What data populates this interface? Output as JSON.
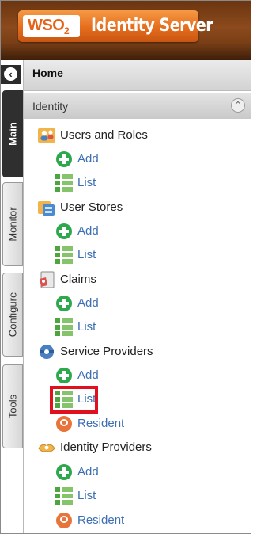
{
  "app": {
    "logo_brand": "WSO",
    "logo_sub": "2",
    "logo_product": "Identity Server"
  },
  "tabs": [
    {
      "label": "Main",
      "active": true
    },
    {
      "label": "Monitor",
      "active": false
    },
    {
      "label": "Configure",
      "active": false
    },
    {
      "label": "Tools",
      "active": false
    }
  ],
  "collapse_icon": "chevron-left-icon",
  "home_label": "Home",
  "section": {
    "label": "Identity",
    "toggle_icon": "chevron-up-icon"
  },
  "groups": {
    "users": {
      "label": "Users and Roles",
      "add": "Add",
      "list": "List"
    },
    "stores": {
      "label": "User Stores",
      "add": "Add",
      "list": "List"
    },
    "claims": {
      "label": "Claims",
      "add": "Add",
      "list": "List"
    },
    "sp": {
      "label": "Service Providers",
      "add": "Add",
      "list": "List",
      "resident": "Resident"
    },
    "idp": {
      "label": "Identity Providers",
      "add": "Add",
      "list": "List",
      "resident": "Resident"
    }
  },
  "colors": {
    "link": "#3c6fb2",
    "highlight": "#e0101e",
    "header": "#7a3f16",
    "logo": "#e56d1d"
  }
}
